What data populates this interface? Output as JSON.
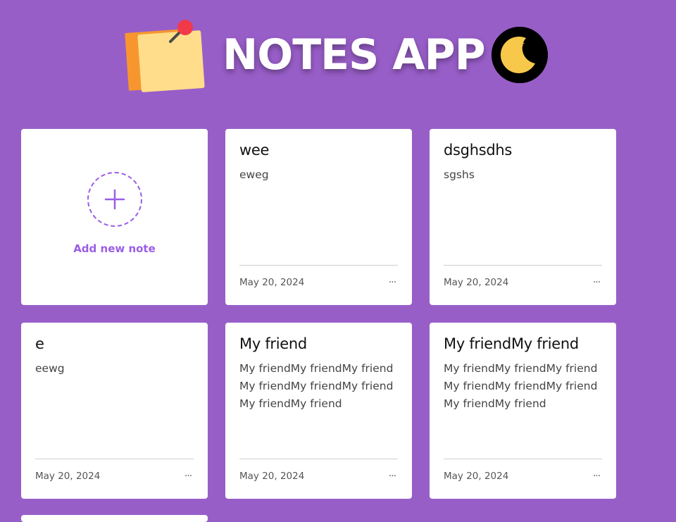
{
  "app": {
    "title": "NOTES APP",
    "theme_icon": "moon-stars-icon",
    "logo_icon": "sticky-notes-pin-icon"
  },
  "colors": {
    "background": "#985ec8",
    "accent": "#9b5de5",
    "card": "#ffffff"
  },
  "add_note": {
    "label": "Add new note",
    "icon": "plus-icon"
  },
  "notes": [
    {
      "title": "wee",
      "body": "eweg",
      "date": "May 20, 2024",
      "menu": "..."
    },
    {
      "title": "dsghsdhs",
      "body": "sgshs",
      "date": "May 20, 2024",
      "menu": "..."
    },
    {
      "title": "e",
      "body": "eewg",
      "date": "May 20, 2024",
      "menu": "..."
    },
    {
      "title": "My friend",
      "body": "My friendMy friendMy friendMy friendMy friendMy friendMy friendMy friend",
      "date": "May 20, 2024",
      "menu": "..."
    },
    {
      "title": "My friendMy friend",
      "body": "My friendMy friendMy friendMy friendMy friendMy friendMy friendMy friend",
      "date": "May 20, 2024",
      "menu": "..."
    }
  ]
}
